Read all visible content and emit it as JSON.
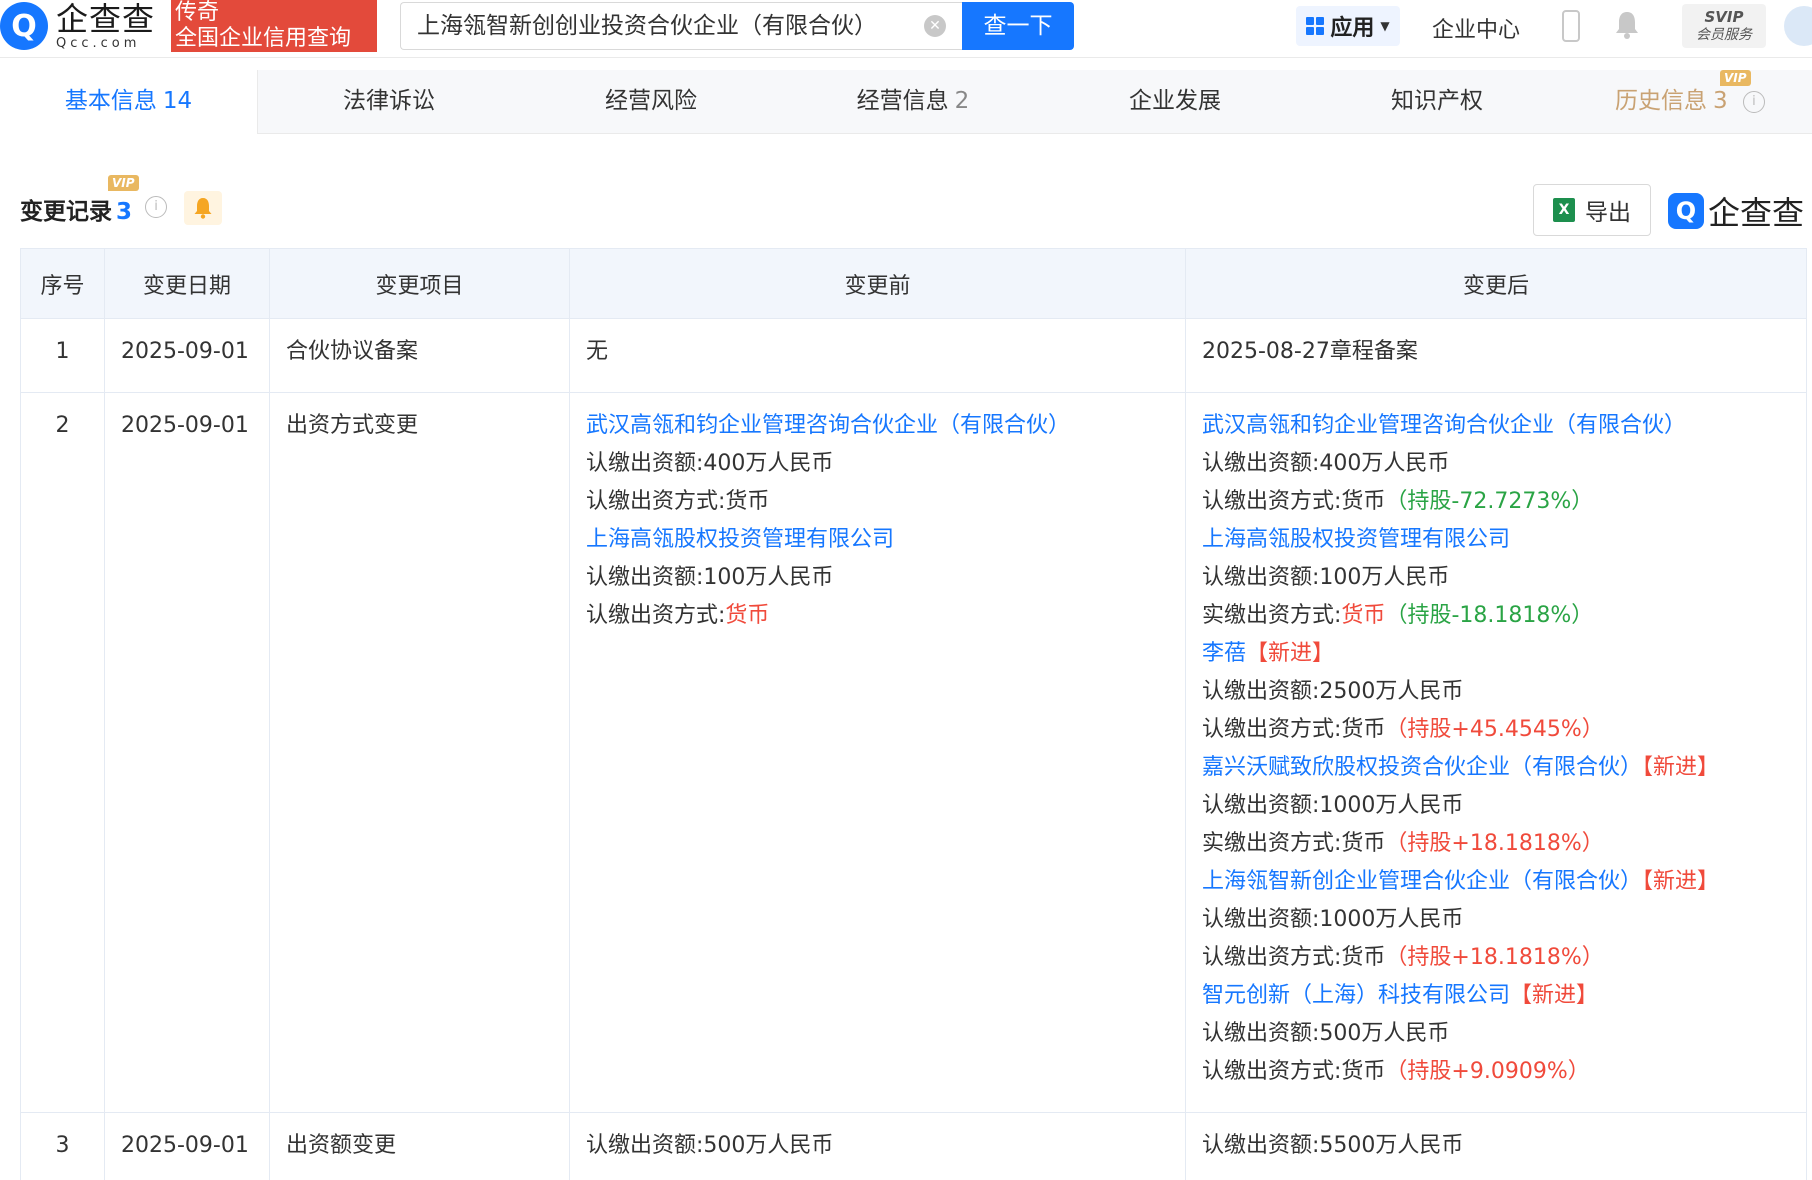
{
  "header": {
    "logo_text": "企查查",
    "logo_sub": "Qcc.com",
    "slogan_line1": "传奇",
    "slogan_line2": "全国企业信用查询",
    "search_value": "上海瓴智新创创业投资合伙企业（有限合伙）",
    "search_button": "查一下",
    "app_label": "应用",
    "enterprise_center": "企业中心",
    "svip_line1": "SVIP",
    "svip_line2": "会员服务"
  },
  "tabs": [
    {
      "label": "基本信息",
      "count": "14"
    },
    {
      "label": "法律诉讼",
      "count": ""
    },
    {
      "label": "经营风险",
      "count": ""
    },
    {
      "label": "经营信息",
      "count": "2"
    },
    {
      "label": "企业发展",
      "count": ""
    },
    {
      "label": "知识产权",
      "count": ""
    },
    {
      "label": "历史信息",
      "count": "3",
      "vip": "VIP"
    }
  ],
  "section": {
    "title": "变更记录",
    "count": "3",
    "vip": "VIP",
    "export_label": "导出",
    "brand": "企查查"
  },
  "table": {
    "headers": [
      "序号",
      "变更日期",
      "变更项目",
      "变更前",
      "变更后"
    ],
    "rows": [
      {
        "index": "1",
        "date": "2025-09-01",
        "item": "合伙协议备案",
        "before": "无",
        "after": "2025-08-27章程备案"
      },
      {
        "index": "2",
        "date": "2025-09-01",
        "item": "出资方式变更",
        "before": {
          "p1_name": "武汉高瓴和钧企业管理咨询合伙企业（有限合伙）",
          "p1_amount": "认缴出资额:400万人民币",
          "p1_method": "认缴出资方式:货币",
          "p2_name": "上海高瓴股权投资管理有限公司",
          "p2_amount": "认缴出资额:100万人民币",
          "p2_method_label": "认缴出资方式:",
          "p2_method_value": "货币"
        },
        "after": {
          "p1_name": "武汉高瓴和钧企业管理咨询合伙企业（有限合伙）",
          "p1_amount": "认缴出资额:400万人民币",
          "p1_method": "认缴出资方式:货币",
          "p1_share": "（持股-72.7273%）",
          "p2_name": "上海高瓴股权投资管理有限公司",
          "p2_amount": "认缴出资额:100万人民币",
          "p2_method_label": "实缴出资方式:",
          "p2_method_value": "货币",
          "p2_share": "（持股-18.1818%）",
          "p3_name": "李蓓",
          "p3_tag": "【新进】",
          "p3_amount": "认缴出资额:2500万人民币",
          "p3_method": "认缴出资方式:货币",
          "p3_share": "（持股+45.4545%）",
          "p4_name": "嘉兴沃赋致欣股权投资合伙企业（有限合伙）",
          "p4_tag": "【新进】",
          "p4_amount": "认缴出资额:1000万人民币",
          "p4_method": "实缴出资方式:货币",
          "p4_share": "（持股+18.1818%）",
          "p5_name": "上海瓴智新创企业管理合伙企业（有限合伙）",
          "p5_tag": "【新进】",
          "p5_amount": "认缴出资额:1000万人民币",
          "p5_method": "认缴出资方式:货币",
          "p5_share": "（持股+18.1818%）",
          "p6_name": "智元创新（上海）科技有限公司",
          "p6_tag": "【新进】",
          "p6_amount": "认缴出资额:500万人民币",
          "p6_method": "认缴出资方式:货币",
          "p6_share": "（持股+9.0909%）"
        }
      },
      {
        "index": "3",
        "date": "2025-09-01",
        "item": "出资额变更",
        "before": "认缴出资额:500万人民币",
        "after": "认缴出资额:5500万人民币"
      }
    ]
  },
  "colors": {
    "brand_blue": "#1677ff",
    "red": "#f04a3b",
    "green": "#2aa445",
    "vip_gold": "#e9b861"
  }
}
